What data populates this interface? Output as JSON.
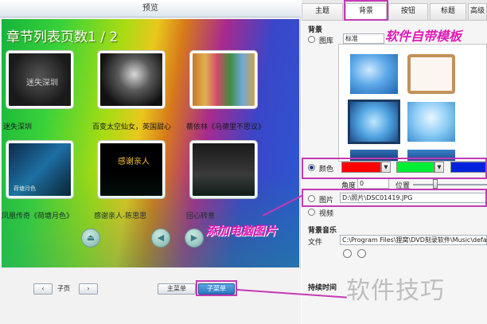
{
  "preview": {
    "window_title": "预览",
    "chapter_title": "章节列表页数1 / 2",
    "thumbs": [
      {
        "caption": "迷失深圳",
        "overlay": "迷失深圳"
      },
      {
        "caption": "百变太空仙女，英国甜心",
        "overlay": ""
      },
      {
        "caption": "蔡依林《马德里不思议》",
        "overlay": ""
      },
      {
        "caption": "凤凰传奇《荷塘月色》",
        "overlay": "荷塘月色"
      },
      {
        "caption": "感谢亲人-陈思思",
        "overlay": "感谢亲人"
      },
      {
        "caption": "回心转意",
        "overlay": ""
      }
    ],
    "prev_page_label": "子页",
    "main_menu_label": "主菜单",
    "sub_menu_label": "子菜单"
  },
  "panel": {
    "tabs": [
      "主题",
      "背景",
      "按钮",
      "标题",
      "高级"
    ],
    "active_tab": "背景",
    "background_label": "背景",
    "library_label": "图库",
    "library_value": "标准",
    "color_label": "颜色",
    "colors": {
      "color1": "#ff0000",
      "color2": "#00ee33",
      "color3": "#0022dd"
    },
    "angle_label": "角度",
    "angle_value": "0",
    "position_label": "位置",
    "picture_label": "图片",
    "picture_path": "D:\\照片\\DSC01419.JPG",
    "video_label": "视频",
    "bg_music_label": "背景音乐",
    "file_label": "文件",
    "file_path": "C:\\Program Files\\狸窝\\DVD刻录软件\\Music\\defa",
    "duration_label": "持续时间"
  },
  "annotations": {
    "template_note": "软件自带模板",
    "pc_picture_note": "添加电脑图片",
    "watermark": "软件技巧"
  }
}
